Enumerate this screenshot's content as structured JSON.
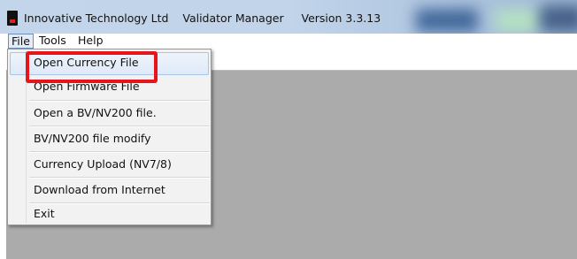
{
  "window": {
    "title_company": "Innovative Technology Ltd",
    "title_app": "Validator Manager",
    "title_version": "Version 3.3.13"
  },
  "menubar": {
    "file": "File",
    "tools": "Tools",
    "help": "Help"
  },
  "file_menu": {
    "items": [
      "Open Currency File",
      "Open Firmware File",
      "Open a BV/NV200 file.",
      "BV/NV200 file modify",
      "Currency Upload (NV7/8)",
      "Download from Internet",
      "Exit"
    ],
    "hovered_item": "Open Currency File"
  },
  "annotation": {
    "highlight_color": "#e8141b"
  },
  "colors": {
    "titlebar": "#c3d5ea",
    "client_background": "#ababab",
    "menu_background": "#f2f2f2"
  }
}
